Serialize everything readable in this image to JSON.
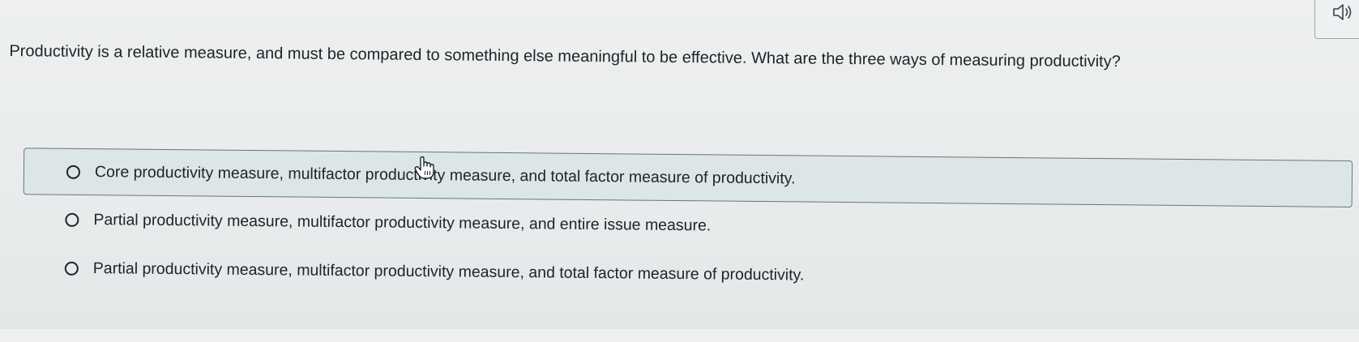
{
  "question": {
    "text": "Productivity is a relative measure, and must be compared to something else meaningful to be effective. What are the three ways of measuring productivity?"
  },
  "options": [
    {
      "label": "Core productivity measure, multifactor productivity measure, and total factor measure of productivity.",
      "selected": false,
      "highlighted": true
    },
    {
      "label": "Partial productivity measure, multifactor productivity measure, and entire issue measure.",
      "selected": false,
      "highlighted": false
    },
    {
      "label": "Partial productivity measure, multifactor productivity measure, and total factor measure of productivity.",
      "selected": false,
      "highlighted": false
    }
  ],
  "audio": {
    "icon": "speaker-icon"
  },
  "cursor": {
    "icon": "hand-pointer-icon"
  },
  "colors": {
    "background": "#e9ecec",
    "highlight": "#dde6e6",
    "text": "#1e2327",
    "border": "#6d7478"
  }
}
